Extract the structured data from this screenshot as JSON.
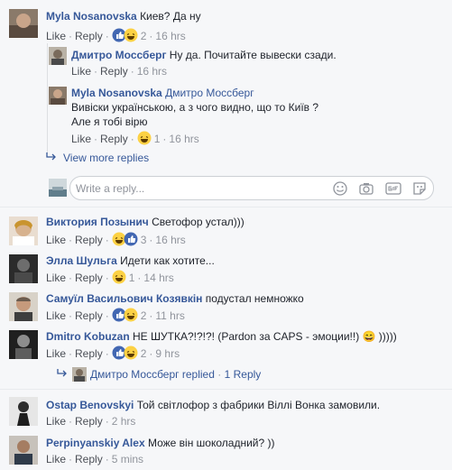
{
  "comments": [
    {
      "author": "Myla Nosanovska",
      "text": "Киев? Да ну",
      "like": "Like",
      "reply": "Reply",
      "reaction_count": "2",
      "time": "16 hrs",
      "reactions": [
        "like",
        "haha"
      ]
    },
    {
      "author": "Дмитро Моссберг",
      "text": "Ну да. Почитайте вывески сзади.",
      "like": "Like",
      "reply": "Reply",
      "time": "16 hrs"
    },
    {
      "author": "Myla Nosanovska",
      "mention": "Дмитро Моссберг",
      "text_line1": "Вивіски українською, а з чого видно, що то Київ ?",
      "text_line2": "Але я тобі вірю",
      "like": "Like",
      "reply": "Reply",
      "reaction_count": "1",
      "time": "16 hrs",
      "reactions": [
        "haha"
      ]
    },
    {
      "author": "Виктория Позынич",
      "text": "Светофор устал)))",
      "like": "Like",
      "reply": "Reply",
      "reaction_count": "3",
      "time": "16 hrs",
      "reactions": [
        "haha",
        "like"
      ]
    },
    {
      "author": "Элла Шульга",
      "text": "Идети как хотите...",
      "like": "Like",
      "reply": "Reply",
      "reaction_count": "1",
      "time": "14 hrs",
      "reactions": [
        "haha"
      ]
    },
    {
      "author": "Самуїл Васильович Козявкін",
      "text": "подустал немножко",
      "like": "Like",
      "reply": "Reply",
      "reaction_count": "2",
      "time": "11 hrs",
      "reactions": [
        "like",
        "haha"
      ]
    },
    {
      "author": "Dmitro Kobuzan",
      "text": "НЕ ШУТКА?!?!?! (Pardon за CAPS - эмоции!!) 😄 )))))",
      "like": "Like",
      "reply": "Reply",
      "reaction_count": "2",
      "time": "9 hrs",
      "reactions": [
        "like",
        "haha"
      ]
    },
    {
      "author": "Ostap Benovskyi",
      "text": "Той світлофор з фабрики Віллі Вонка замовили.",
      "like": "Like",
      "reply": "Reply",
      "time": "2 hrs"
    },
    {
      "author": "Perpinyanskiy Alex",
      "text": "Може він шоколадний? ))",
      "like": "Like",
      "reply": "Reply",
      "time": "5 mins"
    }
  ],
  "view_more_replies": "View more replies",
  "replied_summary": {
    "name": "Дмитро Моссберг",
    "replied": "replied",
    "sep": "·",
    "count": "1 Reply"
  },
  "reply_box": {
    "placeholder": "Write a reply..."
  },
  "separator": "·",
  "colors": {
    "link": "#365899",
    "meta": "#90949c",
    "like_blue": "#4267b2",
    "haha_yellow": "#fcd144"
  }
}
